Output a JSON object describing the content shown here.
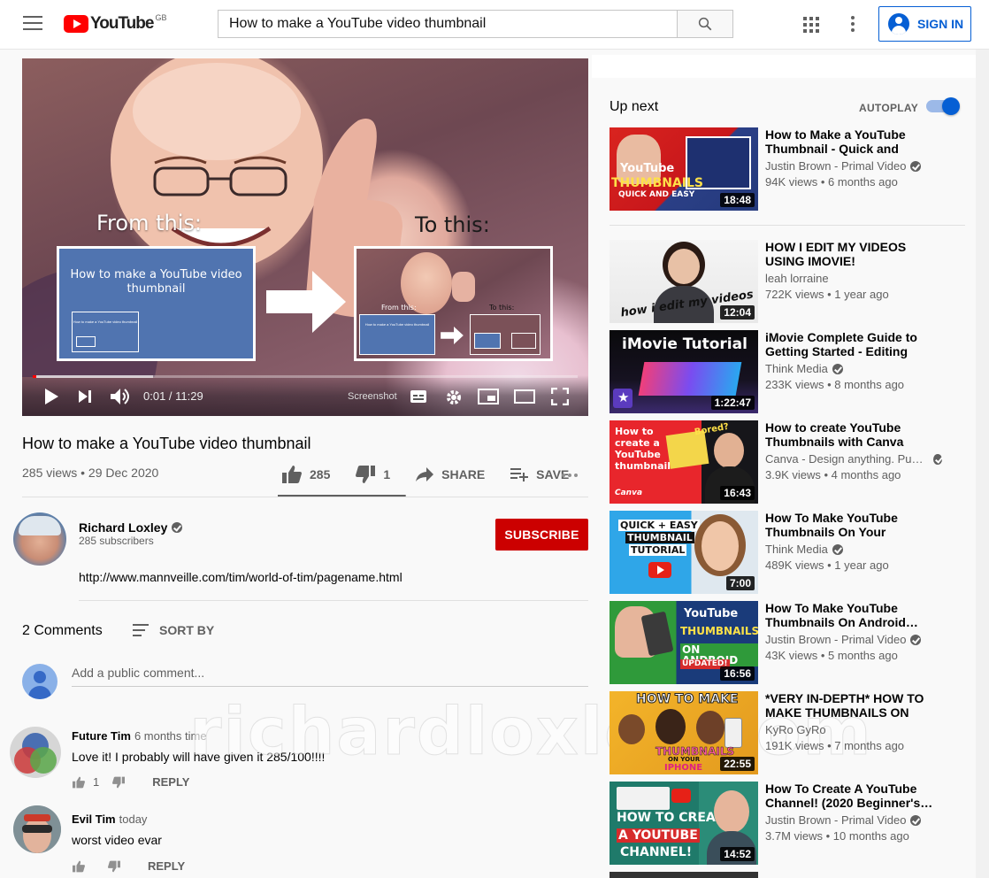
{
  "header": {
    "logo_text": "YouTube",
    "region": "GB",
    "search_value": "How to make a YouTube video thumbnail",
    "signin_label": "SIGN IN"
  },
  "player": {
    "overlay_from": "From this:",
    "overlay_to": "To this:",
    "card_title": "How to make a YouTube video thumbnail",
    "time": "0:01 / 11:29",
    "screenshot_label": "Screenshot",
    "progress_fraction": 0.0015,
    "buffer_fraction": 0.22
  },
  "video": {
    "title": "How to make a YouTube video thumbnail",
    "views_date": "285 views • 29 Dec 2020",
    "likes": "285",
    "dislikes": "1",
    "share_label": "SHARE",
    "save_label": "SAVE",
    "like_ratio": 0.99
  },
  "channel": {
    "name": "Richard Loxley",
    "subscribers": "285 subscribers",
    "subscribe_label": "SUBSCRIBE",
    "description_link": "http://www.mannveille.com/tim/world-of-tim/pagename.html"
  },
  "comments": {
    "count_label": "2 Comments",
    "sort_label": "SORT BY",
    "add_placeholder": "Add a public comment...",
    "items": [
      {
        "author": "Future Tim",
        "time": "6 months time",
        "text": "Love it! I probably will have given it 285/100!!!!",
        "likes": "1",
        "reply_label": "REPLY"
      },
      {
        "author": "Evil Tim",
        "time": "today",
        "text": "worst video evar",
        "likes": "",
        "reply_label": "REPLY"
      }
    ]
  },
  "watermark": "richardloxley.com",
  "sidebar": {
    "up_next_label": "Up next",
    "autoplay_label": "AUTOPLAY",
    "autoplay_on": true,
    "videos": [
      {
        "title": "How to Make a YouTube Thumbnail - Quick and Easy…",
        "channel": "Justin Brown - Primal Video",
        "verified": true,
        "meta": "94K views • 6 months ago",
        "duration": "18:48"
      },
      {
        "title": "HOW I EDIT MY VIDEOS USING IMOVIE!",
        "channel": "leah lorraine",
        "verified": false,
        "meta": "722K views • 1 year ago",
        "duration": "12:04"
      },
      {
        "title": "iMovie Complete Guide to Getting Started - Editing Tutori…",
        "channel": "Think Media",
        "verified": true,
        "meta": "233K views • 8 months ago",
        "duration": "1:22:47"
      },
      {
        "title": "How to create YouTube Thumbnails with Canva",
        "channel": "Canva - Design anything. Pu…",
        "verified": true,
        "meta": "3.9K views • 4 months ago",
        "duration": "16:43"
      },
      {
        "title": "How To Make YouTube Thumbnails On Your Phone…",
        "channel": "Think Media",
        "verified": true,
        "meta": "489K views • 1 year ago",
        "duration": "7:00"
      },
      {
        "title": "How To Make YouTube Thumbnails On Android…",
        "channel": "Justin Brown - Primal Video",
        "verified": true,
        "meta": "43K views • 5 months ago",
        "duration": "16:56"
      },
      {
        "title": "*VERY IN-DEPTH* HOW TO MAKE THUMBNAILS ON YOU…",
        "channel": "KyRo GyRo",
        "verified": false,
        "meta": "191K views • 7 months ago",
        "duration": "22:55"
      },
      {
        "title": "How To Create A YouTube Channel! (2020 Beginner's…",
        "channel": "Justin Brown - Primal Video",
        "verified": true,
        "meta": "3.7M views • 10 months ago",
        "duration": "14:52"
      }
    ],
    "thumb_text": {
      "v0": [
        "YouTube",
        "THUMBNAILS",
        "QUICK AND EASY"
      ],
      "v1": [
        "how i edit my videos"
      ],
      "v2": [
        "iMovie Tutorial"
      ],
      "v3": [
        "How to create a YouTube thumbnail",
        "Bored?",
        "Canva"
      ],
      "v4": [
        "QUICK + EASY",
        "THUMBNAIL",
        "TUTORIAL"
      ],
      "v5": [
        "YouTube",
        "THUMBNAILS",
        "ON ANDROID",
        "UPDATED!"
      ],
      "v6": [
        "HOW TO MAKE",
        "THUMBNAILS",
        "ON YOUR",
        "IPHONE"
      ],
      "v7": [
        "HOW TO CREATE",
        "A YOUTUBE",
        "CHANNEL!"
      ]
    }
  },
  "colors": {
    "brand_red": "#ff0000",
    "subscribe_red": "#cc0000",
    "accent_blue": "#065fd4"
  }
}
